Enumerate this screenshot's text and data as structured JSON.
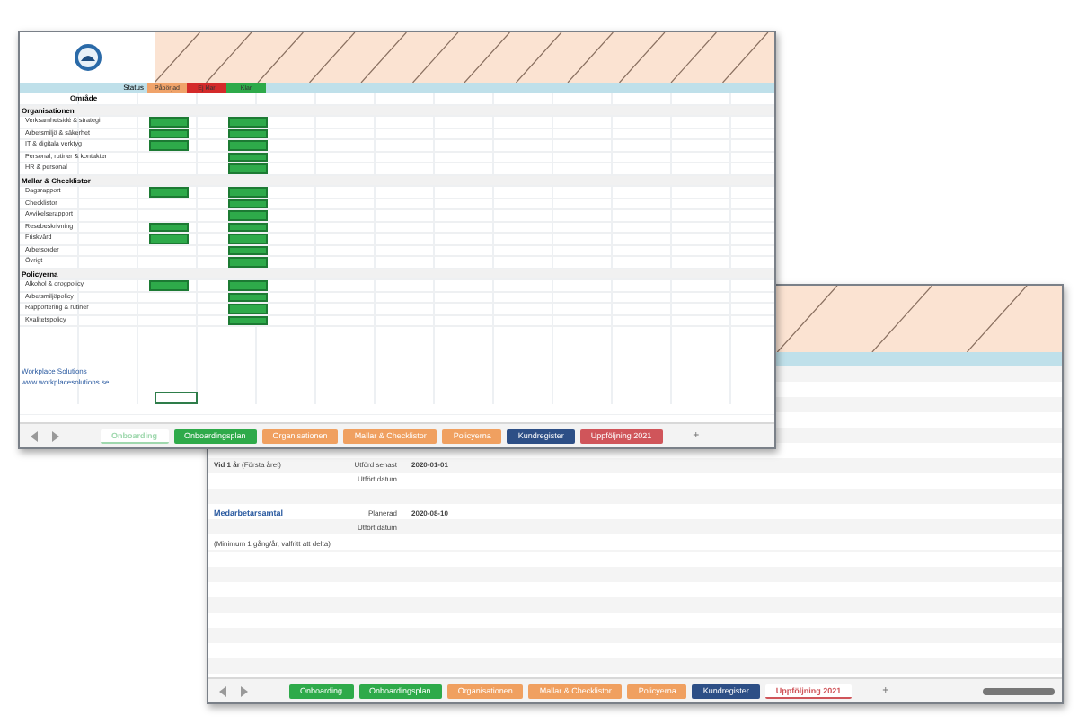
{
  "windows": [
    {
      "kind": "checklist",
      "status": {
        "label": "Status",
        "legend": [
          {
            "label": "Påbörjad",
            "color": "#f0a36a"
          },
          {
            "label": "Ej klar",
            "color": "#d42a2a"
          },
          {
            "label": "Klar",
            "color": "#2eaa4a"
          }
        ]
      },
      "title": "Område",
      "sections": [
        {
          "title": "Organisationen",
          "rows": [
            {
              "label": "Verksamhetsidé & strategi",
              "cells": [
                true,
                false,
                true
              ]
            },
            {
              "label": "Arbetsmiljö & säkerhet",
              "cells": [
                true,
                false,
                true
              ]
            },
            {
              "label": "IT & digitala verktyg",
              "cells": [
                true,
                false,
                true
              ]
            },
            {
              "label": "Personal, rutiner & kontakter",
              "cells": [
                false,
                false,
                true
              ]
            },
            {
              "label": "HR & personal",
              "cells": [
                false,
                false,
                true
              ]
            }
          ]
        },
        {
          "title": "Mallar & Checklistor",
          "rows": [
            {
              "label": "Dagsrapport",
              "cells": [
                true,
                false,
                true
              ]
            },
            {
              "label": "Checklistor",
              "cells": [
                false,
                false,
                true
              ]
            },
            {
              "label": "Avvikelserapport",
              "cells": [
                false,
                false,
                true
              ]
            },
            {
              "label": "Resebeskrivning",
              "cells": [
                true,
                false,
                true
              ]
            },
            {
              "label": "Friskvård",
              "cells": [
                true,
                false,
                true
              ]
            },
            {
              "label": "Arbetsorder",
              "cells": [
                false,
                false,
                true
              ]
            },
            {
              "label": "Övrigt",
              "cells": [
                false,
                false,
                true
              ]
            }
          ]
        },
        {
          "title": "Policyerna",
          "rows": [
            {
              "label": "Alkohol & drogpolicy",
              "cells": [
                true,
                false,
                true
              ]
            },
            {
              "label": "Arbetsmiljöpolicy",
              "cells": [
                false,
                false,
                true
              ]
            },
            {
              "label": "Rapportering & rutiner",
              "cells": [
                false,
                false,
                true
              ]
            },
            {
              "label": "Kvalitetspolicy",
              "cells": [
                false,
                false,
                true
              ]
            }
          ]
        }
      ],
      "links": [
        "Workplace Solutions",
        "www.workplacesolutions.se"
      ],
      "tabs": [
        {
          "label": "Onboarding",
          "color": "#9fd8ae",
          "selected": true
        },
        {
          "label": "Onboardingsplan",
          "color": "#2eaa4a",
          "selected": false
        },
        {
          "label": "Organisationen",
          "color": "#f0a060",
          "selected": false
        },
        {
          "label": "Mallar & Checklistor",
          "color": "#f0a060",
          "selected": false
        },
        {
          "label": "Policyerna",
          "color": "#f0a060",
          "selected": false
        },
        {
          "label": "Kundregister",
          "color": "#2d4f86",
          "selected": false
        },
        {
          "label": "Uppföljning 2021",
          "color": "#d0555a",
          "selected": false
        }
      ],
      "add_tab": "+"
    },
    {
      "kind": "followup",
      "rows": [
        {
          "label": "**Vid 1 år** (Första året)",
          "link": false,
          "field": "Utförd senast",
          "date": "2020-01-01"
        },
        {
          "field": "Utfört datum"
        },
        {
          "label": "Medarbetarsamtal",
          "link": true,
          "field": "Planerad",
          "date": "2020-08-10"
        },
        {
          "field": "Utfört datum"
        },
        {
          "label": "(Minimum 1 gång/år, valfritt att delta)",
          "link": false
        }
      ],
      "tabs": [
        {
          "label": "Onboarding",
          "color": "#2eaa4a",
          "selected": false
        },
        {
          "label": "Onboardingsplan",
          "color": "#2eaa4a",
          "selected": false
        },
        {
          "label": "Organisationen",
          "color": "#f0a060",
          "selected": false
        },
        {
          "label": "Mallar & Checklistor",
          "color": "#f0a060",
          "selected": false
        },
        {
          "label": "Policyerna",
          "color": "#f0a060",
          "selected": false
        },
        {
          "label": "Kundregister",
          "color": "#2d4f86",
          "selected": false
        },
        {
          "label": "Uppföljning 2021",
          "color": "#d0555a",
          "selected": true
        }
      ],
      "add_tab": "+"
    }
  ]
}
